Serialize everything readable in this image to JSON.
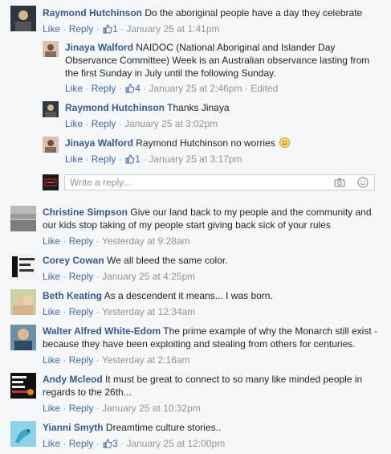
{
  "common": {
    "like": "Like",
    "reply": "Reply",
    "dot": "·"
  },
  "comments": [
    {
      "author": "Raymond Hutchinson",
      "text": "Do the aboriginal people have a day they celebrate",
      "likes": "1",
      "time": "January 25 at 1:41pm"
    },
    {
      "author": "Jinaya Walford",
      "text": "NAIDOC (National Aboriginal and Islander Day Observance Committee) Week is an Australian observance lasting from the first Sunday in July until the following Sunday.",
      "likes": "4",
      "time": "January 25 at 2:46pm",
      "edited": "Edited"
    },
    {
      "author": "Raymond Hutchinson",
      "text": "Thanks Jinaya",
      "time": "January 25 at 3:02pm"
    },
    {
      "author": "Jinaya Walford",
      "text": "Raymond Hutchinson no worries",
      "likes": "1",
      "time": "January 25 at 3:17pm"
    },
    {
      "author": "Christine Simpson",
      "text": "Give our land back to my people and the community and our kids stop taking of my people start giving back sick of your rules",
      "time": "Yesterday at 9:28am"
    },
    {
      "author": "Corey Cowan",
      "text": "We all bleed the same color.",
      "time": "January 25 at 4:25pm"
    },
    {
      "author": "Beth Keating",
      "text": "As a descendent it means... I was born.",
      "time": "Yesterday at 12:34am"
    },
    {
      "author": "Walter Alfred White-Edom",
      "text": "The prime example of why the Monarch still exist - because they have been exploiting and stealing from others for centuries.",
      "time": "Yesterday at 2:16am"
    },
    {
      "author": "Andy Mcleod",
      "text": "It must be great to connect to so many like minded people in regards to the 26th...",
      "time": "January 25 at 10:32pm"
    },
    {
      "author": "Yianni Smyth",
      "text": "Dreamtime culture stories..",
      "likes": "3",
      "time": "January 25 at 12:00pm"
    }
  ],
  "reply_box": {
    "placeholder": "Write a reply..."
  },
  "icons": {
    "like": "thumbs-up-icon",
    "camera": "camera-icon",
    "emoji": "smiley-icon"
  },
  "colors": {
    "link": "#365899",
    "action": "#4267b2",
    "meta": "#90949c",
    "background": "#f6f7f9"
  }
}
